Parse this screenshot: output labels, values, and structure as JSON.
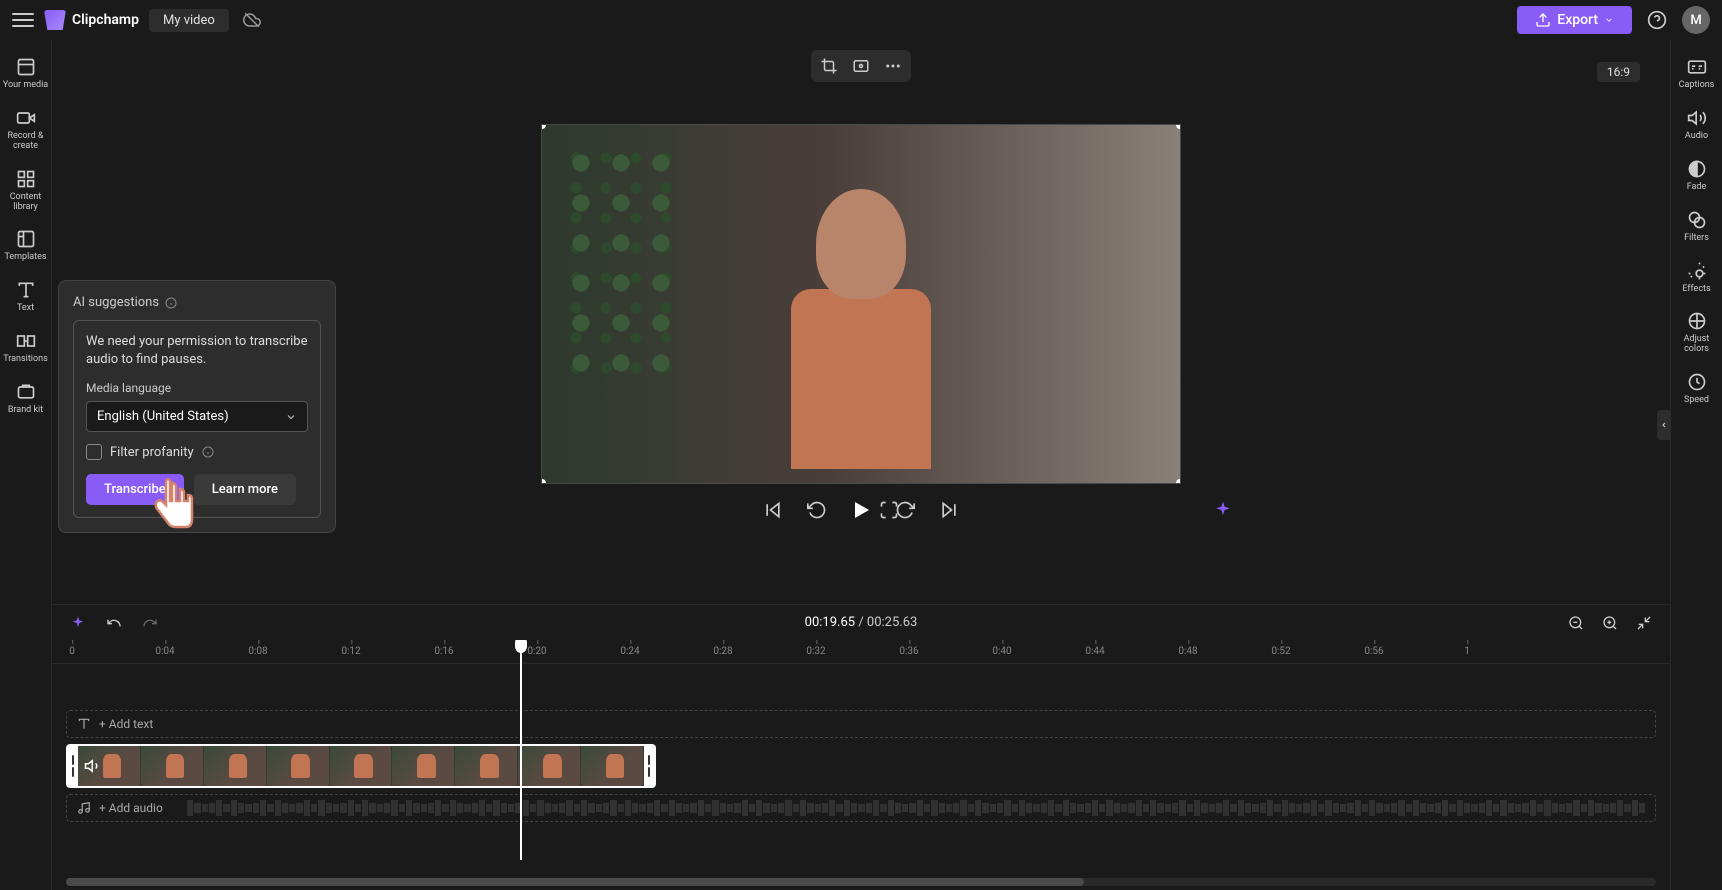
{
  "header": {
    "app_name": "Clipchamp",
    "project_title": "My video",
    "export_label": "Export",
    "avatar_initial": "M"
  },
  "left_nav": [
    {
      "label": "Your media"
    },
    {
      "label": "Record & create"
    },
    {
      "label": "Content library"
    },
    {
      "label": "Templates"
    },
    {
      "label": "Text"
    },
    {
      "label": "Transitions"
    },
    {
      "label": "Brand kit"
    }
  ],
  "right_nav": [
    {
      "label": "Captions"
    },
    {
      "label": "Audio"
    },
    {
      "label": "Fade"
    },
    {
      "label": "Filters"
    },
    {
      "label": "Effects"
    },
    {
      "label": "Adjust colors"
    },
    {
      "label": "Speed"
    }
  ],
  "preview": {
    "aspect_ratio": "16:9"
  },
  "time": {
    "current": "00:19.65",
    "separator": "/",
    "total": "00:25.63"
  },
  "ruler": [
    "0",
    "0:04",
    "0:08",
    "0:12",
    "0:16",
    "0:20",
    "0:24",
    "0:28",
    "0:32",
    "0:36",
    "0:40",
    "0:44",
    "0:48",
    "0:52",
    "0:56",
    "1"
  ],
  "tracks": {
    "text_label": "+ Add text",
    "audio_label": "+ Add audio"
  },
  "ai_popup": {
    "title": "AI suggestions",
    "description": "We need your permission to transcribe audio to find pauses.",
    "language_label": "Media language",
    "language_value": "English (United States)",
    "profanity_label": "Filter profanity",
    "transcribe_btn": "Transcribe",
    "learn_more_btn": "Learn more"
  }
}
